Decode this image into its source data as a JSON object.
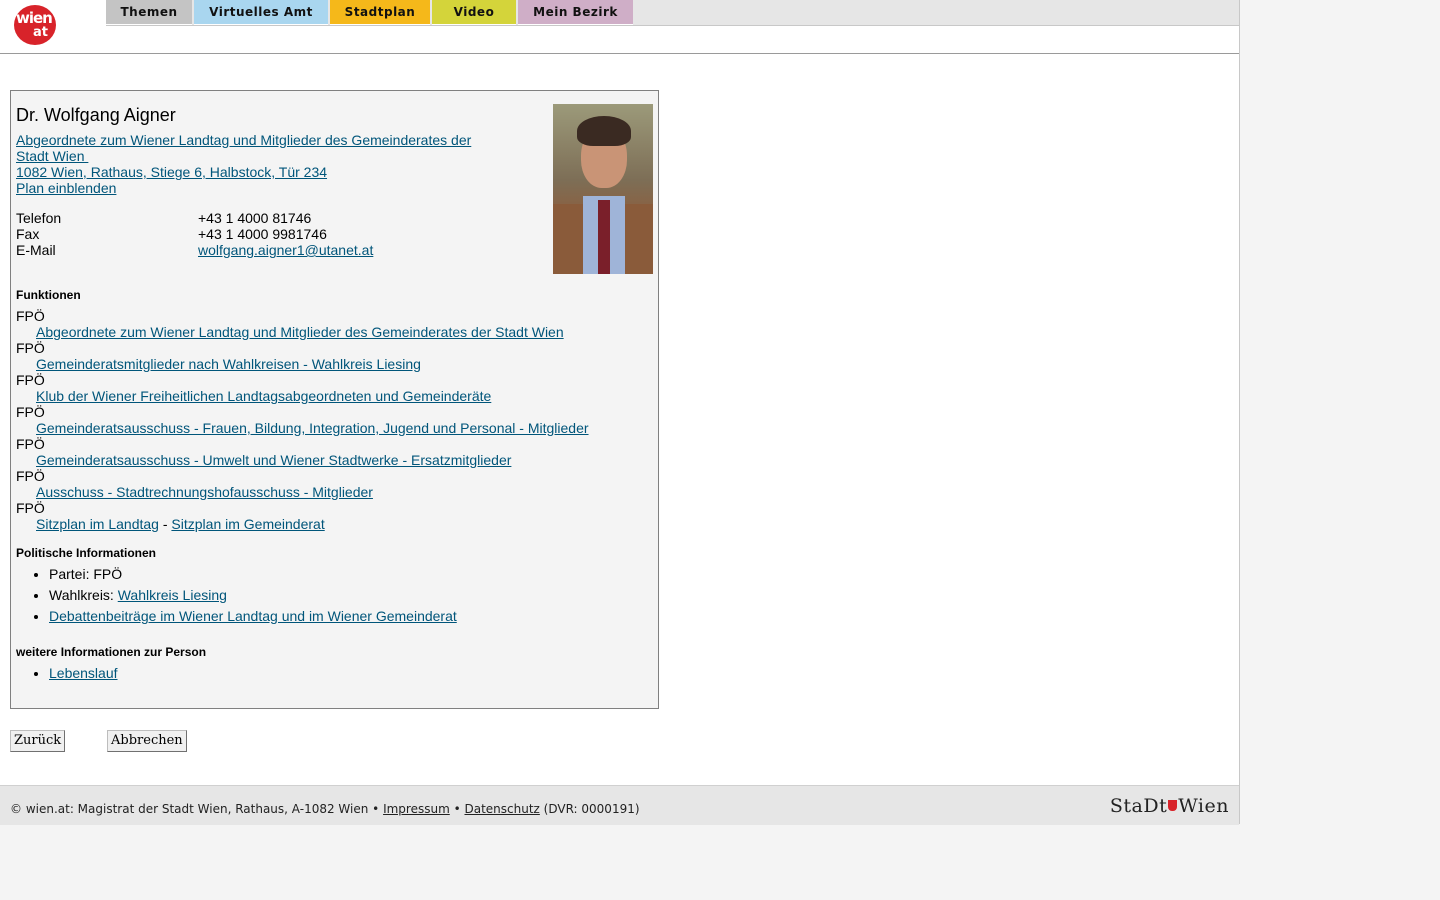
{
  "header": {
    "logo_word": "wien",
    "logo_at": "at",
    "tabs": [
      {
        "label": "Themen",
        "color": "#c4c4c4"
      },
      {
        "label": "Virtuelles Amt",
        "color": "#a9d6ef"
      },
      {
        "label": "Stadtplan",
        "color": "#f5b81a"
      },
      {
        "label": "Video",
        "color": "#d4d43a"
      },
      {
        "label": "Mein Bezirk",
        "color": "#cfaec7"
      }
    ]
  },
  "person": {
    "name": "Dr. Wolfgang Aigner",
    "role_link_line1": "Abgeordnete zum Wiener Landtag und Mitglieder des Gemeinderates der",
    "role_link_line2": "Stadt Wien",
    "address_link": "1082 Wien, Rathaus, Stiege 6, Halbstock, Tür 234",
    "plan_link": "Plan einblenden",
    "contact": {
      "phone_label": "Telefon",
      "phone": "+43 1 4000 81746",
      "fax_label": "Fax",
      "fax": "+43 1 4000 9981746",
      "email_label": "E-Mail",
      "email": "wolfgang.aigner1@utanet.at"
    }
  },
  "functions": {
    "heading": "Funktionen",
    "items": [
      {
        "party": "FPÖ",
        "link": "Abgeordnete zum Wiener Landtag und Mitglieder des Gemeinderates der Stadt Wien"
      },
      {
        "party": "FPÖ",
        "link": "Gemeinderatsmitglieder nach Wahlkreisen - Wahlkreis Liesing"
      },
      {
        "party": "FPÖ",
        "link": "Klub der Wiener Freiheitlichen Landtagsabgeordneten und Gemeinderäte"
      },
      {
        "party": "FPÖ",
        "link": "Gemeinderatsausschuss - Frauen, Bildung, Integration, Jugend und Personal - Mitglieder"
      },
      {
        "party": "FPÖ",
        "link": "Gemeinderatsausschuss - Umwelt und Wiener Stadtwerke - Ersatzmitglieder"
      },
      {
        "party": "FPÖ",
        "link": "Ausschuss - Stadtrechnungshofausschuss - Mitglieder"
      },
      {
        "party": "FPÖ"
      }
    ],
    "seat_landtag": "Sitzplan im Landtag",
    "seat_sep": " - ",
    "seat_gemeinderat": "Sitzplan im Gemeinderat"
  },
  "political": {
    "heading": "Politische Informationen",
    "party_label": "Partei: FPÖ",
    "district_label": "Wahlkreis: ",
    "district_link": "Wahlkreis Liesing",
    "debate_link": "Debattenbeiträge im Wiener Landtag und im Wiener Gemeinderat"
  },
  "further": {
    "heading": "weitere Informationen zur Person",
    "cv_link": "Lebenslauf"
  },
  "buttons": {
    "back": "Zurück",
    "cancel": "Abbrechen"
  },
  "footer": {
    "copyright": "© wien.at: Magistrat der Stadt Wien, Rathaus, A-1082 Wien • ",
    "impressum": "Impressum",
    "bullet": " • ",
    "datenschutz": "Datenschutz",
    "dvr": " (DVR: 0000191)",
    "brand_left": "StaDt",
    "brand_right": "Wien"
  }
}
